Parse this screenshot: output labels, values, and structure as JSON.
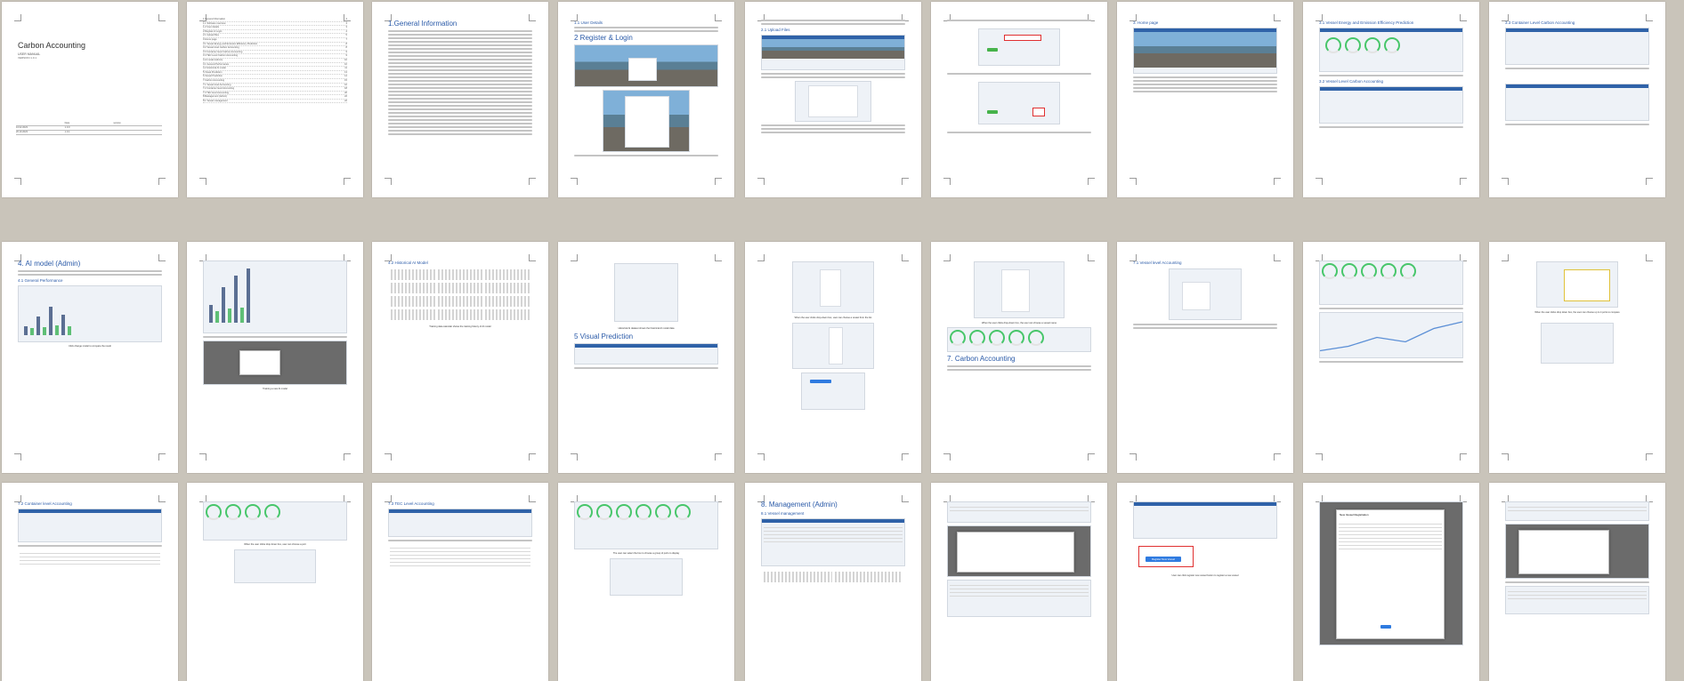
{
  "document": {
    "title": "Carbon Accounting",
    "subtitle": "USER MANUAL",
    "version": "VERSION 1.0.1",
    "history_headers": [
      "Date",
      "version"
    ],
    "history_rows": [
      [
        "10.02.2023",
        "1.0.0"
      ],
      [
        "20.10.2023",
        "1.0.1"
      ]
    ]
  },
  "headings": {
    "general_info": "1.General Information",
    "login_file": "1.1 User Details",
    "register": "2 Register & Login",
    "upload": "2.1 Upload Files",
    "home": "3. Home page",
    "ai_model": "3.1 Vessel Energy and Emission Efficiency Prediction",
    "ai_model2": "3.2 Vessel Level Carbon Accounting",
    "ai_model_title": "3.3 Container Level Carbon Accounting",
    "ai_model_admin": "4. AI model (Admin)",
    "perf": "4.1 General Performance",
    "historical": "4.2 Historical AI Model",
    "visual": "5 Visual Prediction",
    "carbon": "7. Carbon Accounting",
    "vessel_level": "7.1 Vessel level Accounting",
    "container": "7.2 Container level Accounting",
    "tec": "7.3 TEC Level Accounting",
    "mgmt": "8. Management (Admin)",
    "user_mgmt": "8.1 Vessel management",
    "new_vessel": "New Vessel Registration",
    "vessel_mgmt_btn": "Register New Vessel"
  },
  "captions": {
    "c1": "Click change model to compare the result",
    "c2": "Training a new AI model",
    "c3": "Training data calendar shows the training history of AI model",
    "c4": "Historical AI dataset shows the historical AI model data",
    "c5": "When the user clicks drop-down box, user can choose a vessel from the list",
    "c6": "When the user clicks drop-down box, the user can choose a vessel name",
    "c7": "When the user clicks drop down box, the user can choose up to 4 ports to compare",
    "c8": "When the user clicks drop down box, user can choose a port",
    "c9": "The user can select the box to choose a group of ports to display",
    "c10": "User can click register new vessel button to register a new vessel"
  },
  "toc": [
    [
      "1.General Information",
      "3"
    ],
    [
      "1.1 Software overview",
      "3"
    ],
    [
      "1.2 User details",
      "3"
    ],
    [
      "2.Register & Login",
      "4"
    ],
    [
      "2.1 Upload files",
      "5"
    ],
    [
      "3.Home page",
      "7"
    ],
    [
      "3.1 Vessel Energy and Emission Efficiency Prediction",
      "8"
    ],
    [
      "3.2 Vessel level Carbon Accounting",
      "8"
    ],
    [
      "3.3 Container level Carbon Accounting",
      "9"
    ],
    [
      "3.4 TEC Level Carbon Accounting",
      "9"
    ],
    [
      "4.AI model (Admin)",
      "10"
    ],
    [
      "4.1 General Performance",
      "10"
    ],
    [
      "4.2 Historical AI model",
      "11"
    ],
    [
      "5.Visual Prediction",
      "13"
    ],
    [
      "6.Vessel Prediction",
      "14"
    ],
    [
      "7.Carbon Accounting",
      "15"
    ],
    [
      "7.1 Vessel level Accounting",
      "16"
    ],
    [
      "7.2 Container level Accounting",
      "18"
    ],
    [
      "7.3 TEC level Accounting",
      "20"
    ],
    [
      "8.Management (Admin)",
      "22"
    ],
    [
      "8.1 Vessel management",
      "22"
    ]
  ],
  "colors": {
    "background": "#c9c4ba",
    "accent": "#2a5aa8",
    "gauge": "#47c66a",
    "button": "#2f7be0",
    "alert": "#e03030"
  }
}
